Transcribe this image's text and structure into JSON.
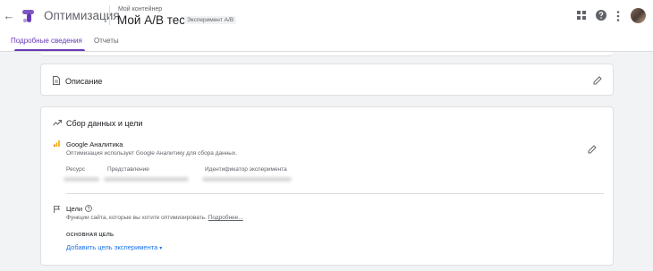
{
  "header": {
    "app_title": "Оптимизация",
    "container_label": "Мой контейнер",
    "experiment_title": "Мой A/B тест",
    "experiment_type": "Эксперимент A/B",
    "back_icon": "←"
  },
  "tabs": [
    {
      "label": "Подробные сведения",
      "active": true
    },
    {
      "label": "Отчеты",
      "active": false
    }
  ],
  "description_card": {
    "title": "Описание"
  },
  "data_card": {
    "title": "Сбор данных и цели",
    "analytics": {
      "title": "Google Аналитика",
      "description": "Оптимизация использует Google Аналитику для сбора данных.",
      "columns": [
        "Ресурс",
        "Представление",
        "Идентификатор эксперимента"
      ]
    },
    "goals": {
      "title": "Цели",
      "description": "Функции сайта, которые вы хотите оптимизировать.",
      "more_link": "Подробнее...",
      "primary_label": "ОСНОВНАЯ ЦЕЛЬ",
      "add_goal": "Добавить цель эксперимента",
      "caret": "▾"
    }
  },
  "colors": {
    "accent": "#673ab7",
    "link": "#1a73e8",
    "analytics_orange": "#f9ab00"
  }
}
